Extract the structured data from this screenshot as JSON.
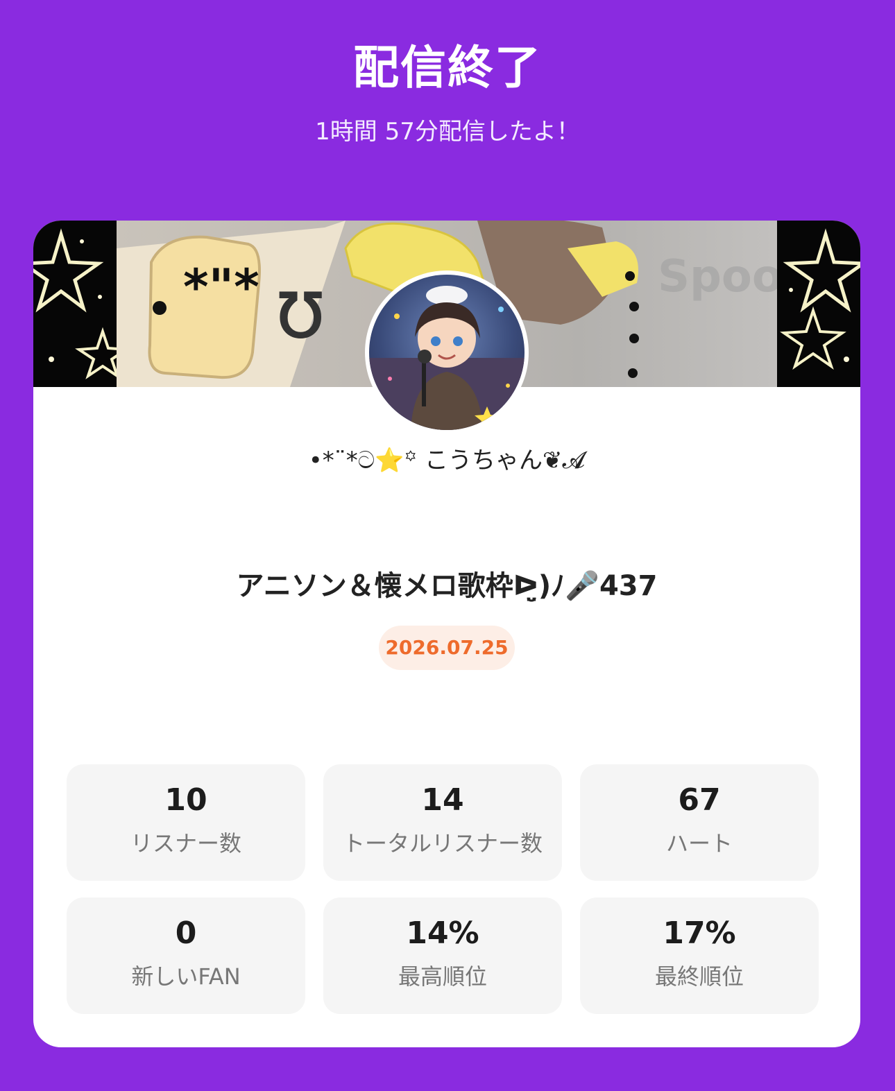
{
  "header": {
    "title": "配信終了",
    "subtitle": "1時間 57分配信したよ！"
  },
  "card": {
    "banner_watermark": "Spoon",
    "username": "•*¨*ට⭐️꙳ こうちゃん❦𝓐",
    "show_title": "アニソン＆懐メロ歌枠ᐅ̤̮)ﾉ🎤437",
    "date": "2026.07.25"
  },
  "stats": [
    {
      "value": "10",
      "label": "リスナー数"
    },
    {
      "value": "14",
      "label": "トータルリスナー数"
    },
    {
      "value": "67",
      "label": "ハート"
    },
    {
      "value": "0",
      "label": "新しいFAN"
    },
    {
      "value": "14%",
      "label": "最高順位"
    },
    {
      "value": "17%",
      "label": "最終順位"
    }
  ],
  "colors": {
    "background": "#8a2be0",
    "date_badge_text": "#ee6b2c",
    "date_badge_bg": "#fdeee6"
  }
}
